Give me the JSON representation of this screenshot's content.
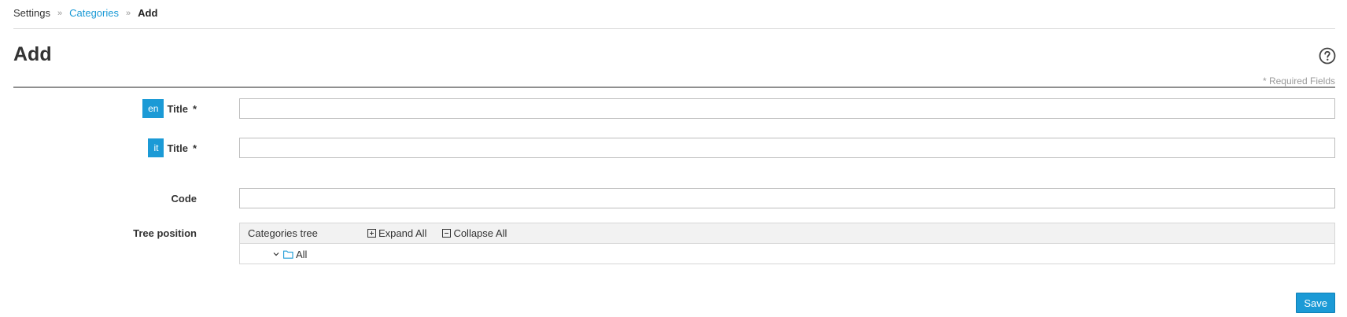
{
  "breadcrumb": {
    "items": [
      "Settings",
      "Categories",
      "Add"
    ],
    "separator": "»"
  },
  "page": {
    "title": "Add",
    "required_note": "* Required Fields"
  },
  "form": {
    "title_en": {
      "lang": "en",
      "label": "Title",
      "required": "*",
      "value": ""
    },
    "title_it": {
      "lang": "it",
      "label": "Title",
      "required": "*",
      "value": ""
    },
    "code": {
      "label": "Code",
      "value": ""
    },
    "tree_position": {
      "label": "Tree position",
      "header": "Categories tree",
      "expand_all": "Expand All",
      "collapse_all": "Collapse All",
      "nodes": [
        {
          "label": "All",
          "icon": "folder-open-icon",
          "expanded": true
        }
      ]
    }
  },
  "actions": {
    "save_label": "Save"
  },
  "colors": {
    "accent": "#1b9ad6",
    "border": "#bdbdbd",
    "rule": "#8f8f8f"
  }
}
